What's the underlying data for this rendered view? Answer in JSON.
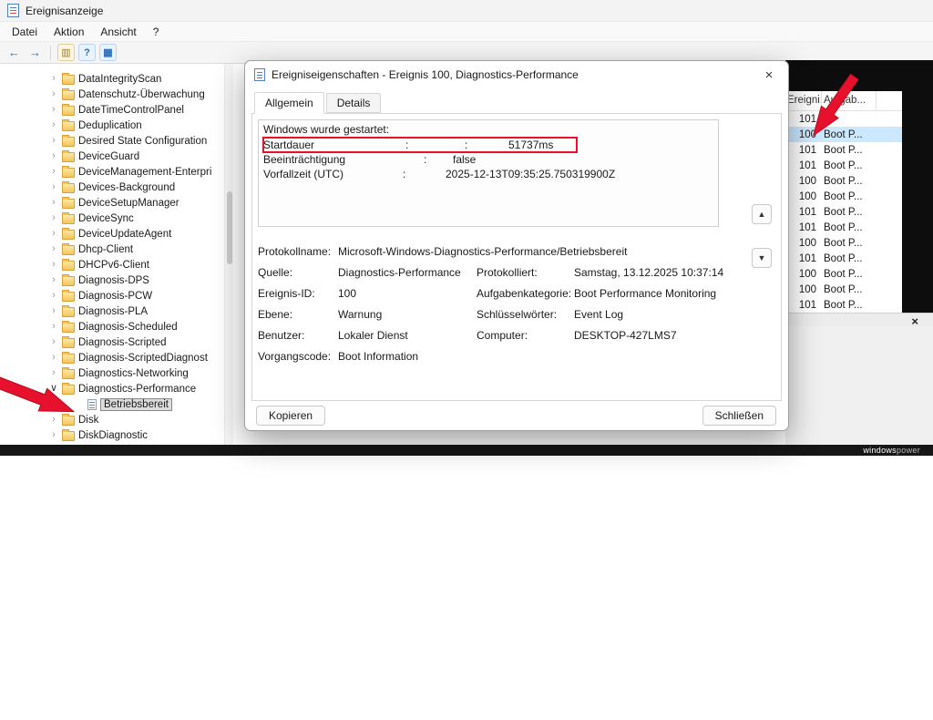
{
  "colors": {
    "accent": "#0078d7",
    "selection": "#cce8ff",
    "annotation": "#e8112d",
    "dark_panel": "#0d0d0d"
  },
  "window": {
    "title": "Ereignisanzeige"
  },
  "menubar": {
    "items": [
      "Datei",
      "Aktion",
      "Ansicht",
      "?"
    ]
  },
  "toolbar": {
    "icons": [
      {
        "name": "back",
        "glyph": "←",
        "style": "tb-arrow"
      },
      {
        "name": "forward",
        "glyph": "→",
        "style": "tb-arrow"
      },
      {
        "name": "show-console-tree",
        "glyph": "▥",
        "style": "tb-panel"
      },
      {
        "name": "help",
        "glyph": "?",
        "style": "tb-blue"
      },
      {
        "name": "help-topics",
        "glyph": "▦",
        "style": "tb-blue"
      }
    ]
  },
  "tree": {
    "items": [
      {
        "label": "DataIntegrityScan"
      },
      {
        "label": "Datenschutz-Überwachung"
      },
      {
        "label": "DateTimeControlPanel"
      },
      {
        "label": "Deduplication"
      },
      {
        "label": "Desired State Configuration"
      },
      {
        "label": "DeviceGuard"
      },
      {
        "label": "DeviceManagement-Enterpri"
      },
      {
        "label": "Devices-Background"
      },
      {
        "label": "DeviceSetupManager"
      },
      {
        "label": "DeviceSync"
      },
      {
        "label": "DeviceUpdateAgent"
      },
      {
        "label": "Dhcp-Client"
      },
      {
        "label": "DHCPv6-Client"
      },
      {
        "label": "Diagnosis-DPS"
      },
      {
        "label": "Diagnosis-PCW"
      },
      {
        "label": "Diagnosis-PLA"
      },
      {
        "label": "Diagnosis-Scheduled"
      },
      {
        "label": "Diagnosis-Scripted"
      },
      {
        "label": "Diagnosis-ScriptedDiagnost"
      },
      {
        "label": "Diagnostics-Networking"
      },
      {
        "label": "Diagnostics-Performance",
        "expanded": true
      },
      {
        "label": "Betriebsbereit",
        "child": true,
        "selected": true
      },
      {
        "label": "Disk"
      },
      {
        "label": "DiskDiagnostic"
      }
    ]
  },
  "event_list": {
    "columns": [
      "Ereigni...",
      "Aufgab..."
    ],
    "rows": [
      {
        "id": "101",
        "task": ""
      },
      {
        "id": "100",
        "task": "Boot P...",
        "selected": true
      },
      {
        "id": "101",
        "task": "Boot P..."
      },
      {
        "id": "101",
        "task": "Boot P..."
      },
      {
        "id": "100",
        "task": "Boot P..."
      },
      {
        "id": "100",
        "task": "Boot P..."
      },
      {
        "id": "101",
        "task": "Boot P..."
      },
      {
        "id": "101",
        "task": "Boot P..."
      },
      {
        "id": "100",
        "task": "Boot P..."
      },
      {
        "id": "101",
        "task": "Boot P..."
      },
      {
        "id": "100",
        "task": "Boot P..."
      },
      {
        "id": "100",
        "task": "Boot P..."
      },
      {
        "id": "101",
        "task": "Boot P..."
      }
    ]
  },
  "preview": {
    "close_glyph": "×"
  },
  "dialog": {
    "title": "Ereigniseigenschaften - Ereignis 100, Diagnostics-Performance",
    "close_glyph": "×",
    "tabs": [
      {
        "label": "Allgemein",
        "active": true
      },
      {
        "label": "Details",
        "active": false
      }
    ],
    "description": {
      "intro": "Windows wurde gestartet:",
      "rows": [
        {
          "label": "Startdauer",
          "c1": ":",
          "c2": ":",
          "value": "51737ms",
          "highlight": true
        },
        {
          "label": "Beeinträchtigung",
          "c1": ":",
          "c2": "",
          "value": "false"
        },
        {
          "label": "Vorfallzeit (UTC)",
          "c1": ":",
          "c2": "",
          "value": "2025-12-13T09:35:25.750319900Z"
        }
      ]
    },
    "scroll_up_glyph": "▲",
    "scroll_down_glyph": "▼",
    "fields": [
      {
        "l1": "Protokollname:",
        "v1": "Microsoft-Windows-Diagnostics-Performance/Betriebsbereit",
        "span": true
      },
      {
        "l1": "Quelle:",
        "v1": "Diagnostics-Performance",
        "l2": "Protokolliert:",
        "v2": "Samstag, 13.12.2025 10:37:14"
      },
      {
        "l1": "Ereignis-ID:",
        "v1": "100",
        "l2": "Aufgabenkategorie:",
        "v2": "Boot Performance Monitoring"
      },
      {
        "l1": "Ebene:",
        "v1": "Warnung",
        "l2": "Schlüsselwörter:",
        "v2": "Event Log"
      },
      {
        "l1": "Benutzer:",
        "v1": "Lokaler Dienst",
        "l2": "Computer:",
        "v2": "DESKTOP-427LMS7"
      },
      {
        "l1": "Vorgangscode:",
        "v1": "Boot Information",
        "l2": "",
        "v2": ""
      }
    ],
    "buttons": {
      "copy": "Kopieren",
      "close": "Schließen"
    }
  },
  "watermark": {
    "part1": "windows",
    "part2": "power"
  }
}
